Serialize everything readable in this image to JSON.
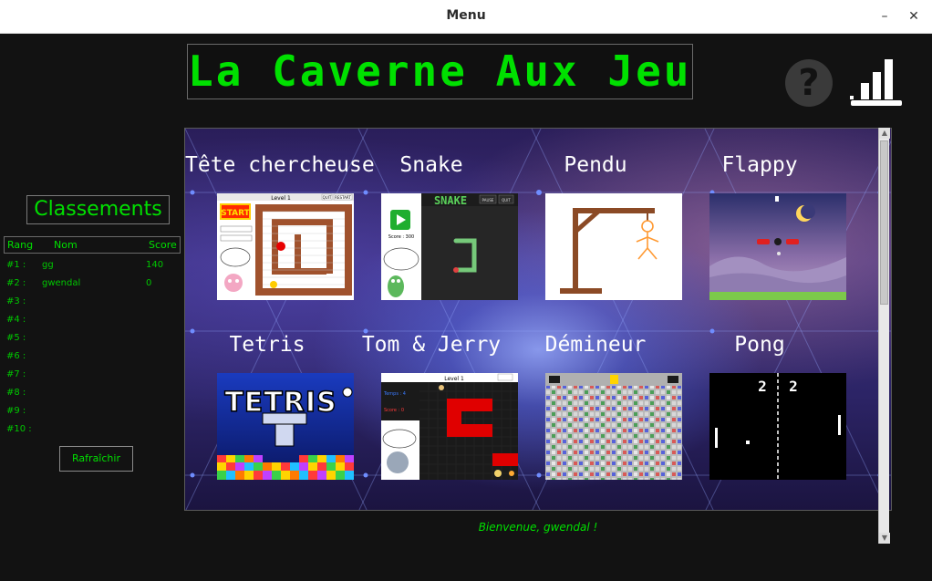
{
  "window": {
    "title": "Menu",
    "minimize": "–",
    "close": "✕"
  },
  "header": {
    "banner": "La Caverne Aux Jeux",
    "help_glyph": "?"
  },
  "sidebar": {
    "title": "Classements",
    "columns": {
      "rank": "Rang",
      "name": "Nom",
      "score": "Score"
    },
    "rows": [
      {
        "rank": "#1 :",
        "name": "gg",
        "score": "140"
      },
      {
        "rank": "#2 :",
        "name": "gwendal",
        "score": "0"
      },
      {
        "rank": "#3 :",
        "name": "",
        "score": ""
      },
      {
        "rank": "#4 :",
        "name": "",
        "score": ""
      },
      {
        "rank": "#5 :",
        "name": "",
        "score": ""
      },
      {
        "rank": "#6 :",
        "name": "",
        "score": ""
      },
      {
        "rank": "#7 :",
        "name": "",
        "score": ""
      },
      {
        "rank": "#8 :",
        "name": "",
        "score": ""
      },
      {
        "rank": "#9 :",
        "name": "",
        "score": ""
      },
      {
        "rank": "#10 :",
        "name": "",
        "score": ""
      }
    ],
    "refresh_label": "Rafraîchir"
  },
  "games": [
    {
      "name": "Tête chercheuse",
      "icon": "maze-game-thumbnail"
    },
    {
      "name": "Snake",
      "icon": "snake-game-thumbnail"
    },
    {
      "name": "Pendu",
      "icon": "hangman-thumbnail"
    },
    {
      "name": "Flappy",
      "icon": "flappy-thumbnail"
    },
    {
      "name": "Tetris",
      "icon": "tetris-thumbnail"
    },
    {
      "name": "Tom & Jerry",
      "icon": "tom-jerry-thumbnail"
    },
    {
      "name": "Démineur",
      "icon": "minesweeper-thumbnail"
    },
    {
      "name": "Pong",
      "icon": "pong-thumbnail"
    }
  ],
  "thumb_text": {
    "maze_level": "Level 1",
    "maze_start": "START",
    "maze_quit": "QUIT",
    "maze_restart": "RESTART",
    "snake_title": "SNAKE",
    "snake_pause": "PAUSE",
    "snake_quit": "QUIT",
    "snake_score": "Score : 300",
    "tetris_logo": "TETRIS",
    "tj_level": "Level 1",
    "tj_time": "Temps : 4",
    "tj_score": "Score : 0",
    "pong_left_score": "2",
    "pong_right_score": "2"
  },
  "welcome": "Bienvenue, gwendal !",
  "colors": {
    "accent": "#00e000",
    "background": "#121212"
  }
}
